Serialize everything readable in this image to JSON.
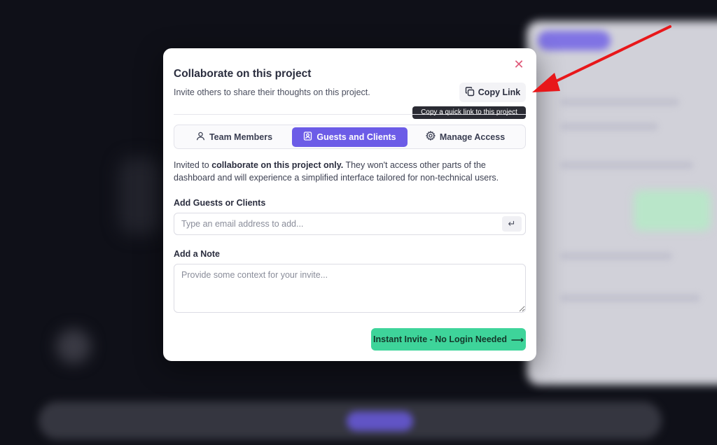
{
  "modal": {
    "title": "Collaborate on this project",
    "subtitle": "Invite others to share their thoughts on this project.",
    "close_icon": "close-icon",
    "copy_link": {
      "label": "Copy Link",
      "icon": "copy-icon"
    },
    "tooltip": "Copy a quick link to this project",
    "tabs": [
      {
        "label": "Team Members",
        "icon": "user-icon",
        "active": false
      },
      {
        "label": "Guests and Clients",
        "icon": "contact-card-icon",
        "active": true
      },
      {
        "label": "Manage Access",
        "icon": "gear-icon",
        "active": false
      }
    ],
    "description": {
      "part1": "Invited to ",
      "bold1": "collaborate on this project only.",
      "part2": " They won't access other parts of the dashboard and will experience a simplified interface tailored for non-technical users."
    },
    "guests": {
      "label": "Add Guests or Clients",
      "placeholder": "Type an email address to add...",
      "value": "",
      "enter_icon": "enter-icon"
    },
    "note": {
      "label": "Add a Note",
      "placeholder": "Provide some context for your invite...",
      "value": ""
    },
    "invite_button": {
      "label": "Instant Invite - No Login Needed",
      "arrow": "⟶"
    }
  },
  "colors": {
    "accent": "#6c5ce7",
    "invite": "#3ed49a",
    "close": "#e05a7a",
    "annotation_arrow": "#e8171a"
  }
}
